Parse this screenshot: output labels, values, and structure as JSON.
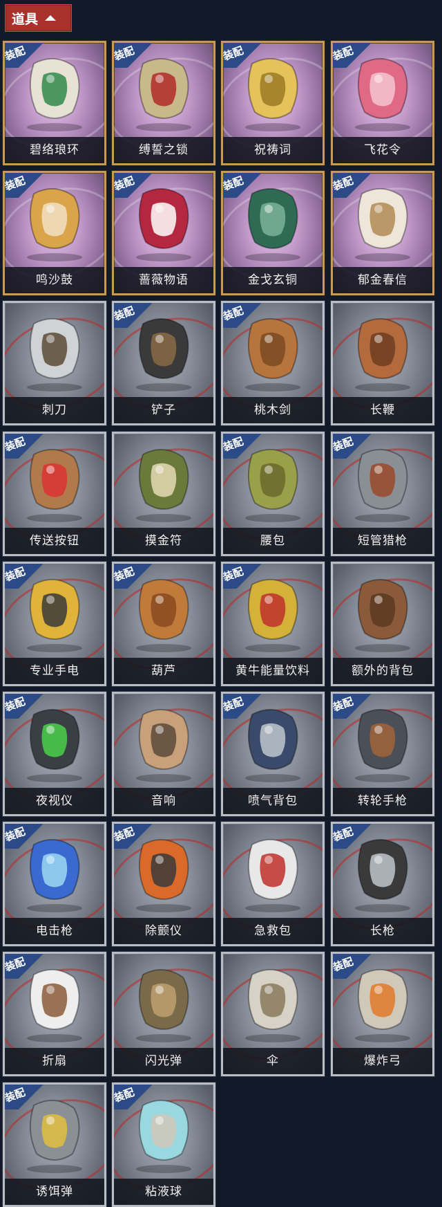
{
  "header": {
    "title": "道具",
    "toggle_icon": "chevron-up-icon"
  },
  "colors": {
    "header_bg": "#a8312c",
    "badge_bg": "#2c4a86",
    "frame_gold": "#c79a55",
    "frame_silver": "#b9bec6",
    "page_bg": "#121a2a"
  },
  "items": [
    {
      "name": "碧络琅环",
      "badge": "装配",
      "bg": "purple",
      "icon": "jade-ring-dagger-icon"
    },
    {
      "name": "缚誓之锁",
      "badge": "装配",
      "bg": "purple",
      "icon": "chain-lock-icon"
    },
    {
      "name": "祝祷词",
      "badge": "装配",
      "bg": "purple",
      "icon": "golden-cross-icon"
    },
    {
      "name": "飞花令",
      "badge": "装配",
      "bg": "purple",
      "icon": "flower-lantern-icon"
    },
    {
      "name": "鸣沙鼓",
      "badge": "装配",
      "bg": "purple",
      "icon": "sand-drum-icon"
    },
    {
      "name": "蔷薇物语",
      "badge": "装配",
      "bg": "purple",
      "icon": "rose-medkit-icon"
    },
    {
      "name": "金戈玄铜",
      "badge": "装配",
      "bg": "purple",
      "icon": "bronze-grenade-icon"
    },
    {
      "name": "郁金春信",
      "badge": "装配",
      "bg": "purple",
      "icon": "paper-umbrella-icon"
    },
    {
      "name": "刺刀",
      "badge": "",
      "bg": "gray",
      "icon": "bayonet-icon"
    },
    {
      "name": "铲子",
      "badge": "装配",
      "bg": "gray",
      "icon": "shovel-icon"
    },
    {
      "name": "桃木剑",
      "badge": "装配",
      "bg": "gray",
      "icon": "wooden-sword-icon"
    },
    {
      "name": "长鞭",
      "badge": "",
      "bg": "gray",
      "icon": "whip-icon"
    },
    {
      "name": "传送按钮",
      "badge": "装配",
      "bg": "gray",
      "icon": "teleport-remote-icon"
    },
    {
      "name": "摸金符",
      "badge": "",
      "bg": "gray",
      "icon": "talisman-icon"
    },
    {
      "name": "腰包",
      "badge": "装配",
      "bg": "gray",
      "icon": "waist-bag-icon"
    },
    {
      "name": "短管猎枪",
      "badge": "装配",
      "bg": "gray",
      "icon": "sawed-off-shotgun-icon"
    },
    {
      "name": "专业手电",
      "badge": "装配",
      "bg": "gray",
      "icon": "flashlight-icon"
    },
    {
      "name": "葫芦",
      "badge": "装配",
      "bg": "gray",
      "icon": "gourd-icon"
    },
    {
      "name": "黄牛能量饮料",
      "badge": "装配",
      "bg": "gray",
      "icon": "energy-drink-icon"
    },
    {
      "name": "额外的背包",
      "badge": "",
      "bg": "gray",
      "icon": "backpack-icon"
    },
    {
      "name": "夜视仪",
      "badge": "装配",
      "bg": "gray",
      "icon": "night-vision-goggles-icon"
    },
    {
      "name": "音响",
      "badge": "",
      "bg": "gray",
      "icon": "radio-speaker-icon"
    },
    {
      "name": "喷气背包",
      "badge": "装配",
      "bg": "gray",
      "icon": "jetpack-icon"
    },
    {
      "name": "转轮手枪",
      "badge": "装配",
      "bg": "gray",
      "icon": "revolver-icon"
    },
    {
      "name": "电击枪",
      "badge": "装配",
      "bg": "gray",
      "icon": "stun-gun-icon"
    },
    {
      "name": "除颤仪",
      "badge": "装配",
      "bg": "gray",
      "icon": "defibrillator-icon"
    },
    {
      "name": "急救包",
      "badge": "",
      "bg": "gray",
      "icon": "first-aid-kit-icon"
    },
    {
      "name": "长枪",
      "badge": "装配",
      "bg": "gray",
      "icon": "spear-icon"
    },
    {
      "name": "折扇",
      "badge": "装配",
      "bg": "gray",
      "icon": "folding-fan-icon"
    },
    {
      "name": "闪光弹",
      "badge": "",
      "bg": "gray",
      "icon": "flashbang-icon"
    },
    {
      "name": "伞",
      "badge": "",
      "bg": "gray",
      "icon": "umbrella-icon"
    },
    {
      "name": "爆炸弓",
      "badge": "装配",
      "bg": "gray",
      "icon": "explosive-bow-icon"
    },
    {
      "name": "诱饵弹",
      "badge": "装配",
      "bg": "gray",
      "icon": "decoy-grenade-icon"
    },
    {
      "name": "粘液球",
      "badge": "装配",
      "bg": "gray",
      "icon": "slime-ball-icon"
    }
  ]
}
